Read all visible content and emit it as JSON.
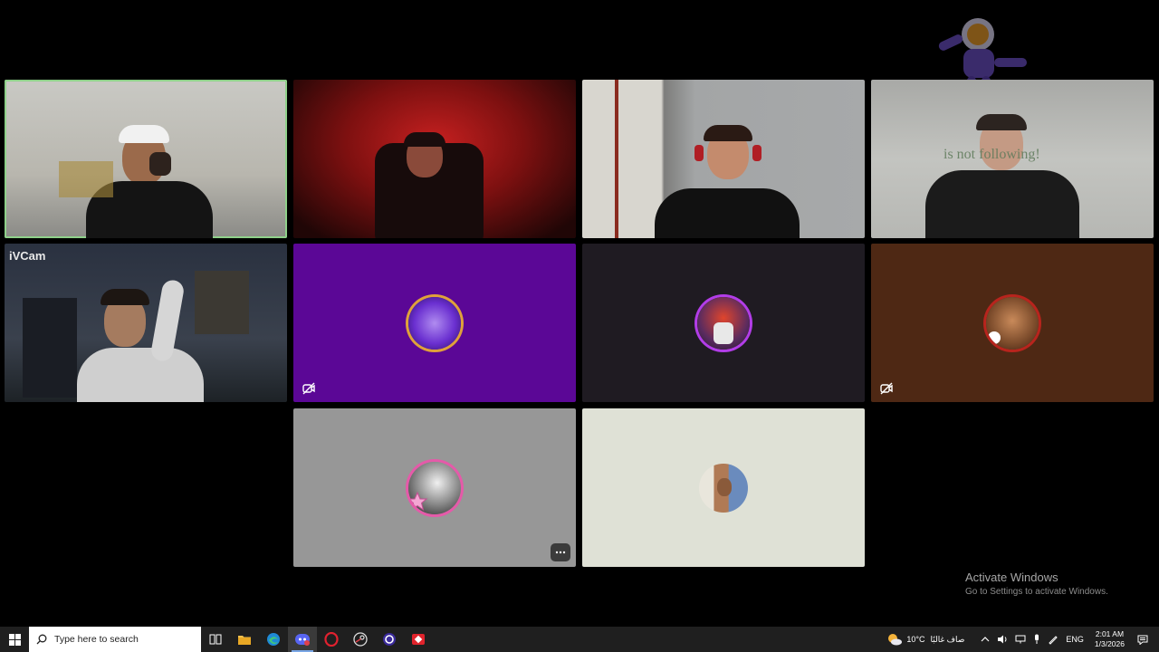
{
  "watermark": {
    "title": "Activate Windows",
    "subtitle": "Go to Settings to activate Windows."
  },
  "participants": [
    {
      "id": "p1",
      "type": "video",
      "speaking": true
    },
    {
      "id": "p2",
      "type": "video"
    },
    {
      "id": "p3",
      "type": "video"
    },
    {
      "id": "p4",
      "type": "video",
      "overlay_text": "is not following!"
    },
    {
      "id": "p5",
      "type": "video",
      "cam_label": "iVCam"
    },
    {
      "id": "p6",
      "type": "avatar",
      "bg": "#5b0796",
      "muted": true
    },
    {
      "id": "p7",
      "type": "avatar",
      "bg": "#1f1b22"
    },
    {
      "id": "p8",
      "type": "avatar",
      "bg": "#4e2814",
      "muted": true
    },
    {
      "id": "p9",
      "type": "avatar",
      "bg": "#979797",
      "more_menu": true
    },
    {
      "id": "p10",
      "type": "avatar",
      "bg": "#dfe1d6"
    }
  ],
  "taskbar": {
    "search_placeholder": "Type here to search",
    "weather_temp": "10°C",
    "weather_text": "صاف غالبًا",
    "language": "ENG",
    "time": "2:01 AM",
    "date": "1/3/2026",
    "apps": [
      "task-view",
      "file-explorer",
      "edge",
      "discord",
      "opera",
      "steam",
      "cortana",
      "anydesk"
    ]
  },
  "colors": {
    "speaking_outline": "#8fd18a",
    "taskbar_bg": "#1f1f1f"
  }
}
